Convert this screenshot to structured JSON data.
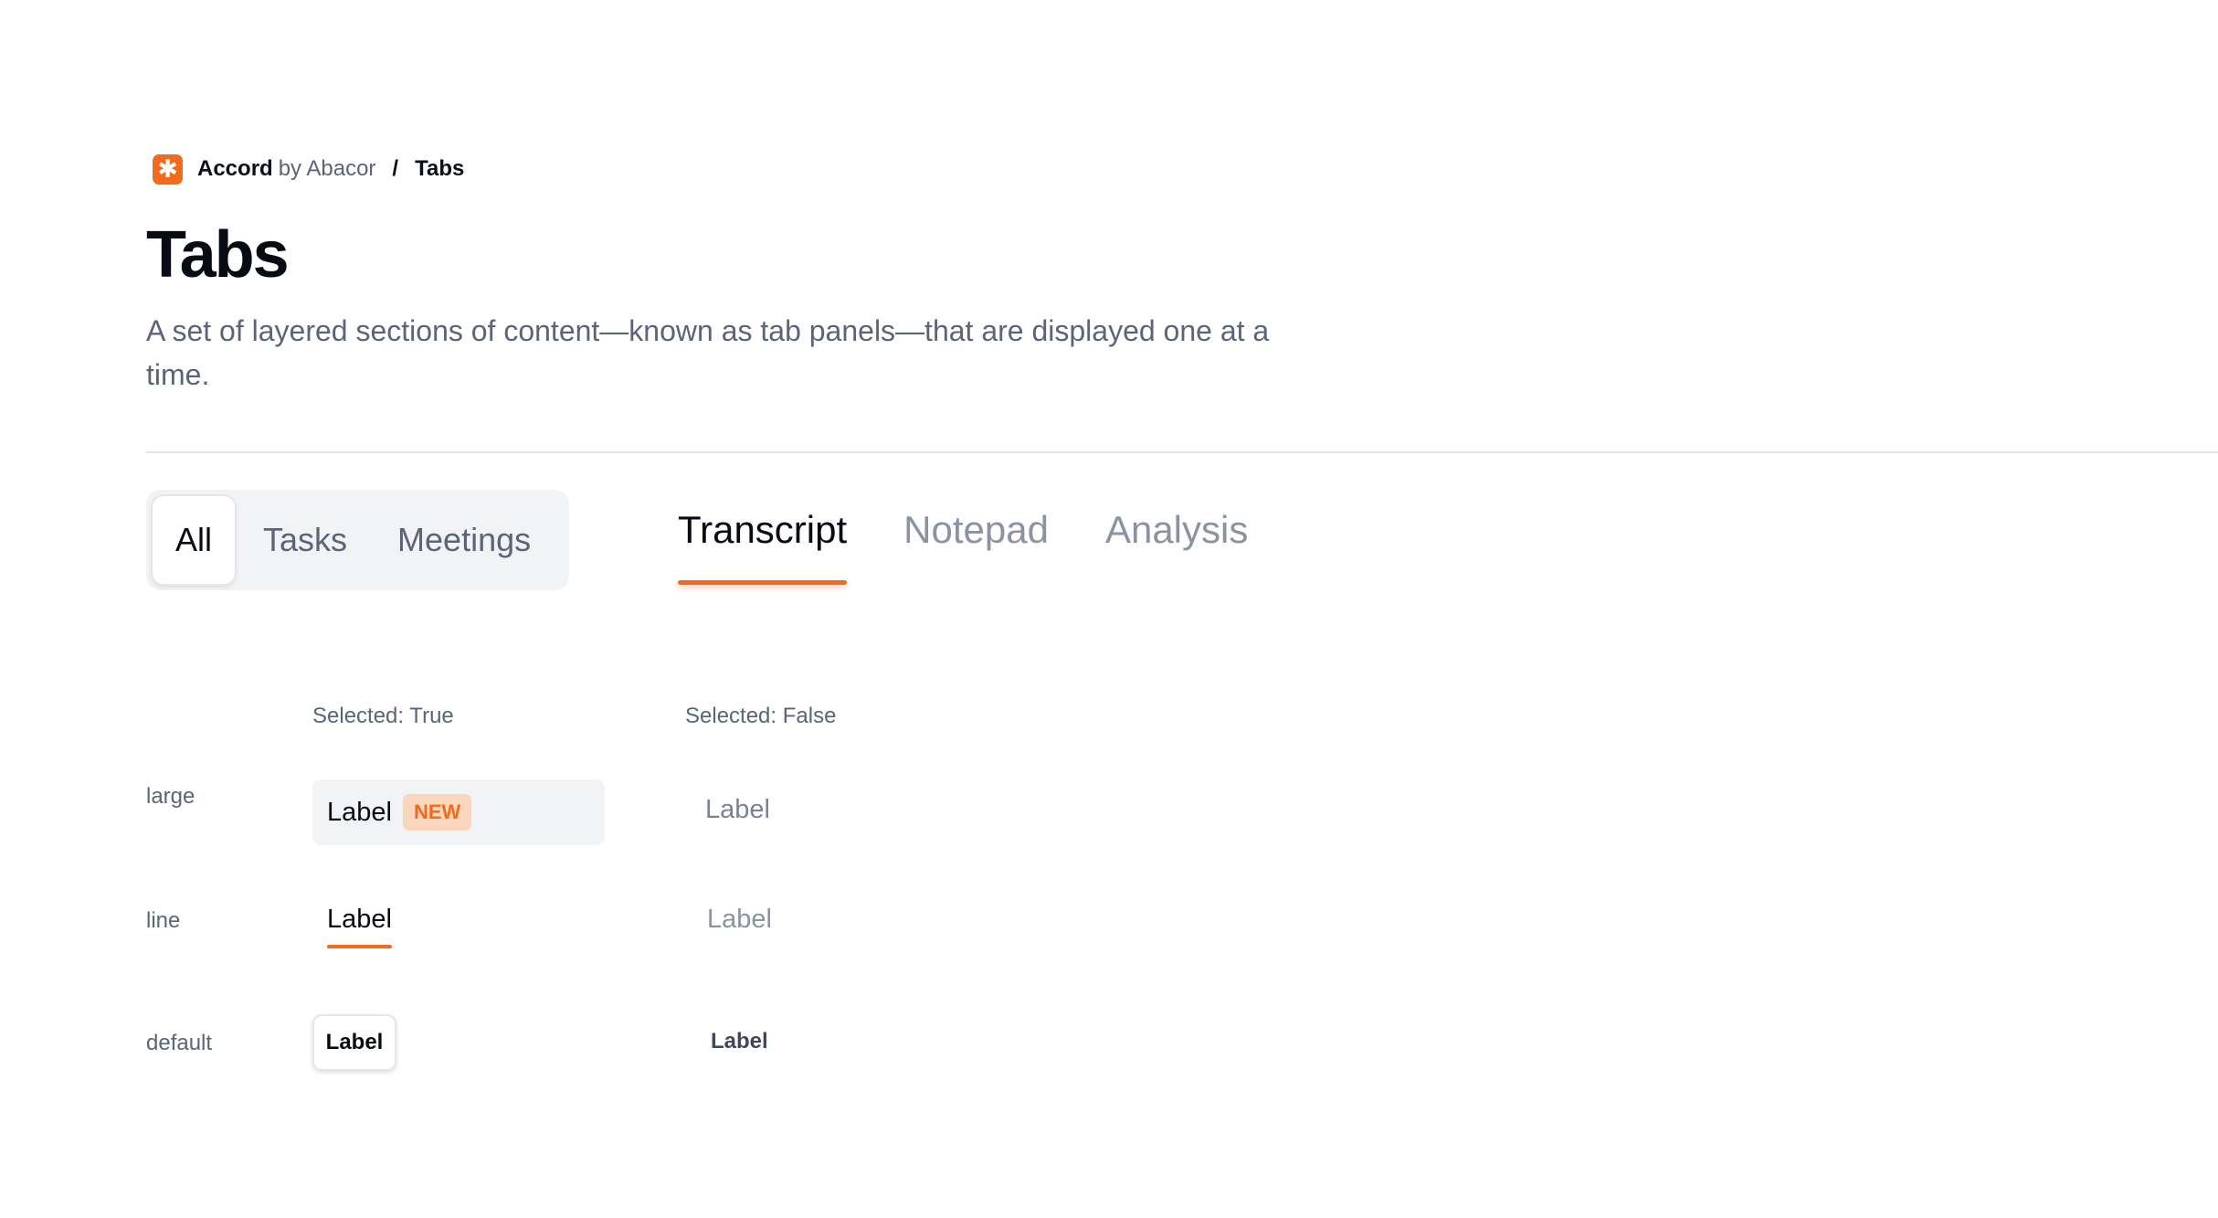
{
  "breadcrumb": {
    "logo_glyph": "✱",
    "brand": "Accord",
    "brand_suffix": "by Abacor",
    "separator": "/",
    "current": "Tabs"
  },
  "page": {
    "title": "Tabs",
    "description": "A set of layered sections of content—known as tab panels—that are displayed one at a time."
  },
  "segmented_tabs": {
    "items": [
      {
        "label": "All",
        "selected": true
      },
      {
        "label": "Tasks",
        "selected": false
      },
      {
        "label": "Meetings",
        "selected": false
      }
    ]
  },
  "line_tabs": {
    "items": [
      {
        "label": "Transcript",
        "selected": true
      },
      {
        "label": "Notepad",
        "selected": false
      },
      {
        "label": "Analysis",
        "selected": false
      }
    ]
  },
  "variants": {
    "col_selected_true": "Selected: True",
    "col_selected_false": "Selected: False",
    "rows": [
      {
        "name": "large",
        "selected_label": "Label",
        "badge": "NEW",
        "unselected_label": "Label"
      },
      {
        "name": "line",
        "selected_label": "Label",
        "unselected_label": "Label"
      },
      {
        "name": "default",
        "selected_label": "Label",
        "unselected_label": "Label"
      }
    ]
  },
  "colors": {
    "accent": "#f26b1d",
    "badge_bg": "#fbd6bf",
    "text_primary": "#070b14",
    "text_muted": "#5b6478"
  }
}
